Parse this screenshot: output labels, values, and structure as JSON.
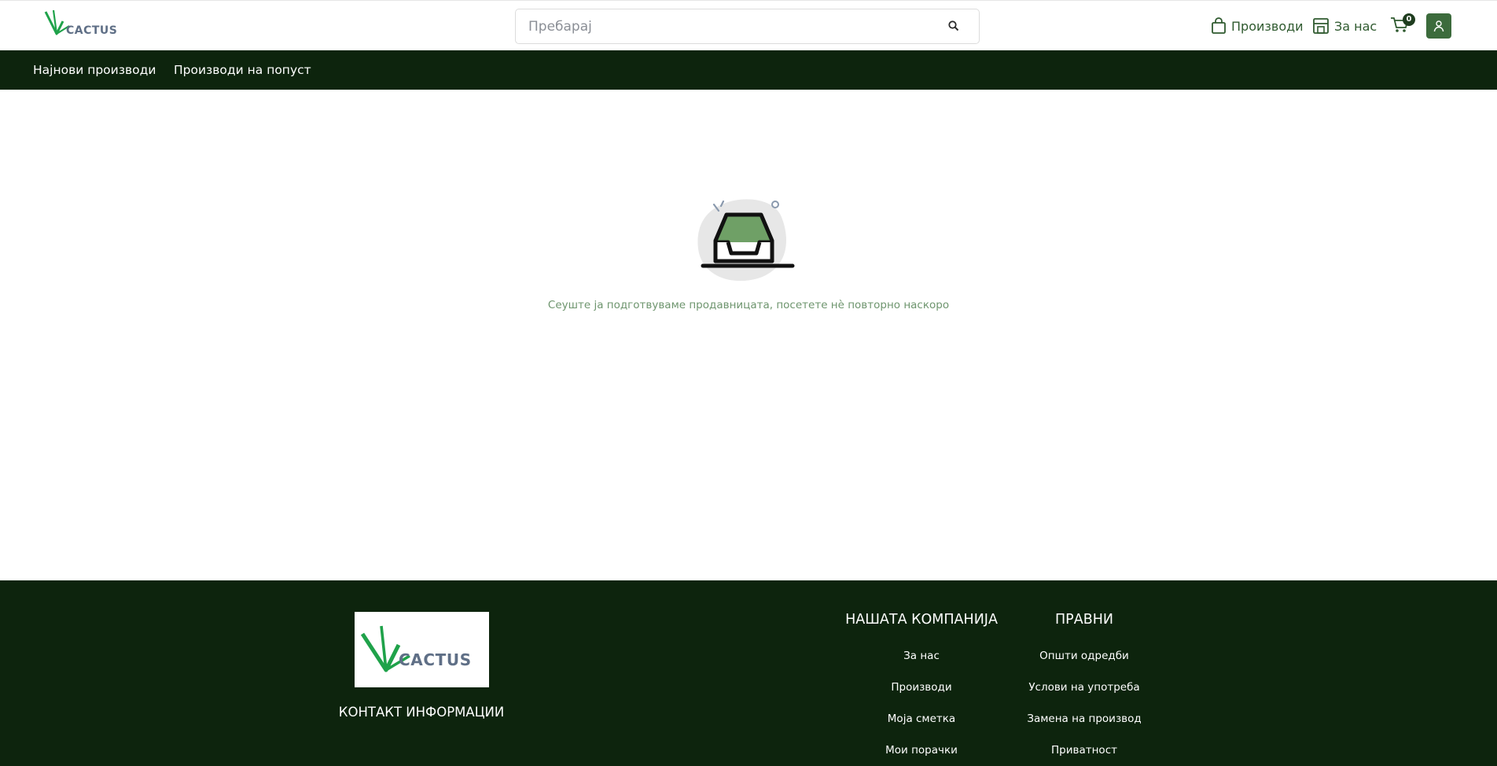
{
  "header": {
    "logo_text": "CACTUS",
    "search": {
      "placeholder": "Пребарај",
      "value": ""
    },
    "nav": {
      "products": "Производи",
      "about": "За нас"
    },
    "cart_count": "0"
  },
  "categories": {
    "items": [
      {
        "label": "Најнови производи"
      },
      {
        "label": "Производи на попуст"
      }
    ]
  },
  "main": {
    "empty_message": "Сеуште ја подготвуваме продавницата, посетете нè повторно наскоро"
  },
  "footer": {
    "logo_text": "CACTUS",
    "contact_title": "КОНТАКТ ИНФОРМАЦИИ",
    "company": {
      "title": "НАШАТА КОМПАНИЈА",
      "links": [
        "За нас",
        "Производи",
        "Моја сметка",
        "Мои порачки"
      ]
    },
    "legal": {
      "title": "ПРАВНИ",
      "links": [
        "Општи одредби",
        "Услови на употреба",
        "Замена на производ",
        "Приватност"
      ]
    }
  },
  "colors": {
    "brand_dark": "#0d240d",
    "brand_green": "#3c6b3c",
    "logo_green": "#1fa24a",
    "logo_text": "#5f6f86",
    "illustration_fill": "#6fa066"
  }
}
